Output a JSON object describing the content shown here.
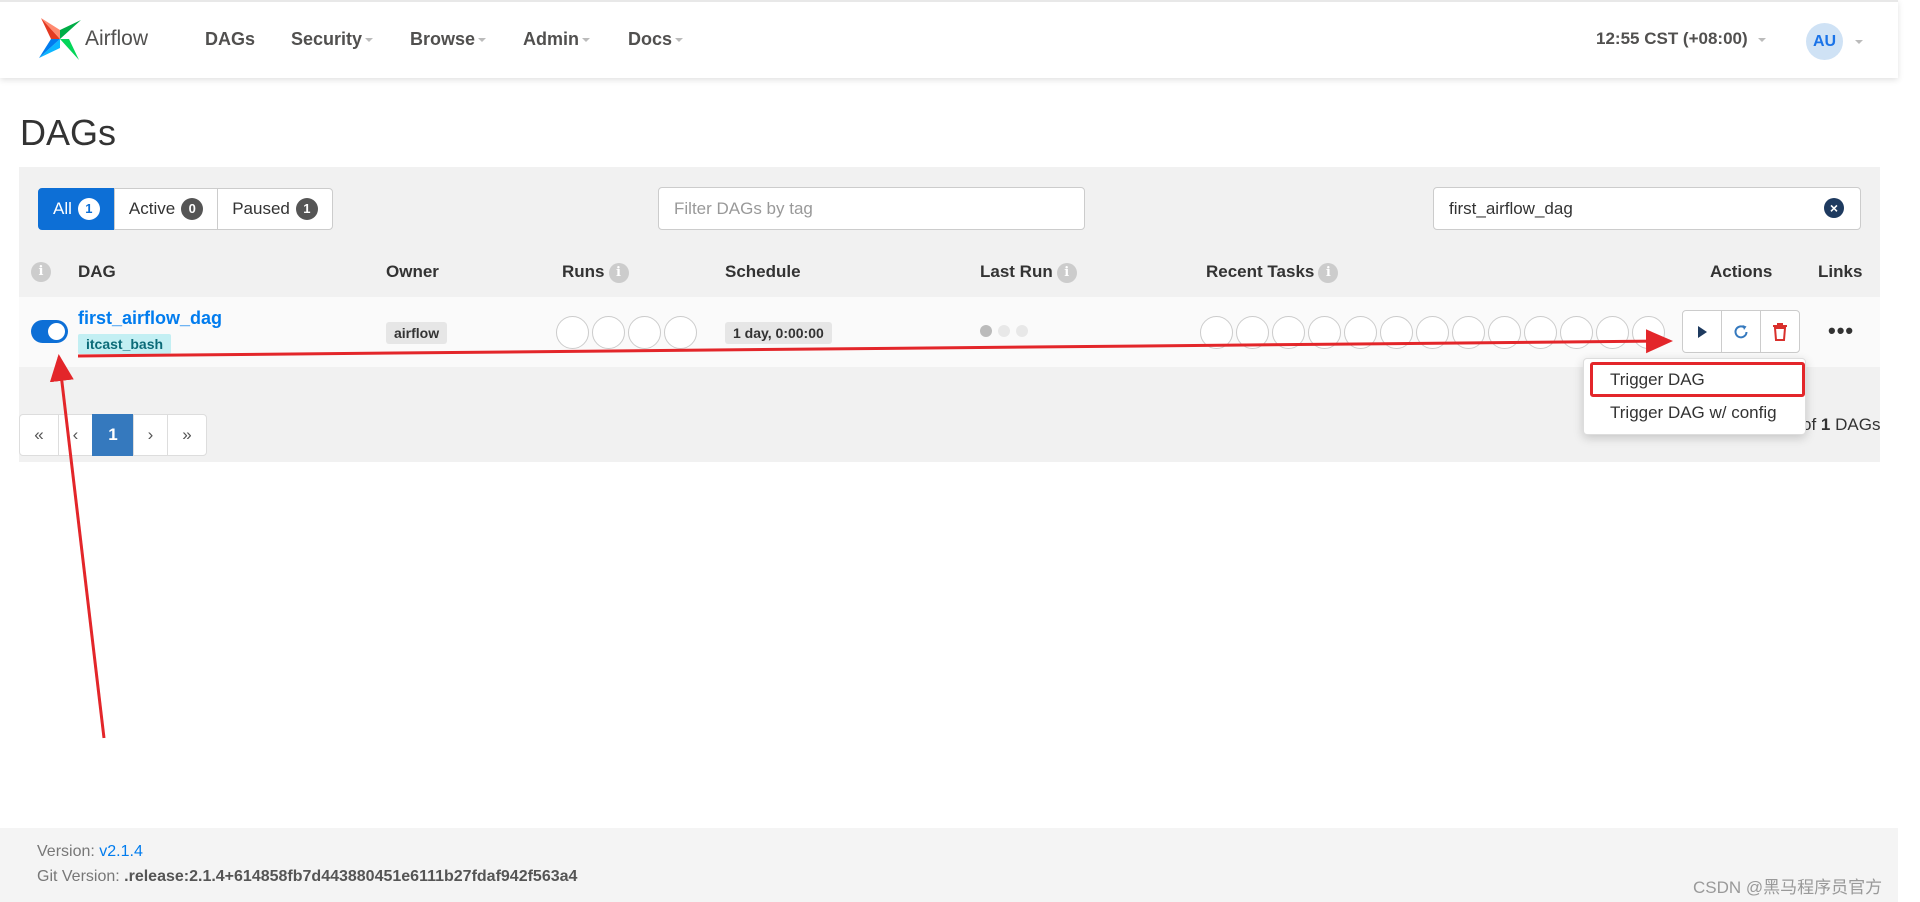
{
  "navbar": {
    "brand": "Airflow",
    "items": [
      "DAGs",
      "Security",
      "Browse",
      "Admin",
      "Docs"
    ],
    "time": "12:55 CST (+08:00)",
    "avatar": "AU"
  },
  "page_title": "DAGs",
  "filters": {
    "all_label": "All",
    "all_count": "1",
    "active_label": "Active",
    "active_count": "0",
    "paused_label": "Paused",
    "paused_count": "1",
    "tag_placeholder": "Filter DAGs by tag",
    "search_value": "first_airflow_dag"
  },
  "table": {
    "headers": {
      "dag": "DAG",
      "owner": "Owner",
      "runs": "Runs",
      "schedule": "Schedule",
      "last_run": "Last Run",
      "recent_tasks": "Recent Tasks",
      "actions": "Actions",
      "links": "Links"
    },
    "row": {
      "dag_id": "first_airflow_dag",
      "tag": "itcast_bash",
      "owner": "airflow",
      "schedule": "1 day, 0:00:00",
      "enabled": true
    }
  },
  "menu": {
    "trigger": "Trigger DAG",
    "trigger_config": "Trigger DAG w/ config"
  },
  "pagination": {
    "first": "«",
    "prev": "‹",
    "current": "1",
    "next": "›",
    "last": "»",
    "count_prefix": "of",
    "count": "1",
    "count_suffix": "DAGs"
  },
  "footer": {
    "version_label": "Version:",
    "version": "v2.1.4",
    "git_label": "Git Version:",
    "git": ".release:2.1.4+614858fb7d443880451e6111b27fdaf942f563a4"
  },
  "watermark": "CSDN @黑马程序员官方",
  "colors": {
    "primary": "#0d6fd6",
    "annotation": "#e3262a",
    "danger": "#d9302c"
  }
}
